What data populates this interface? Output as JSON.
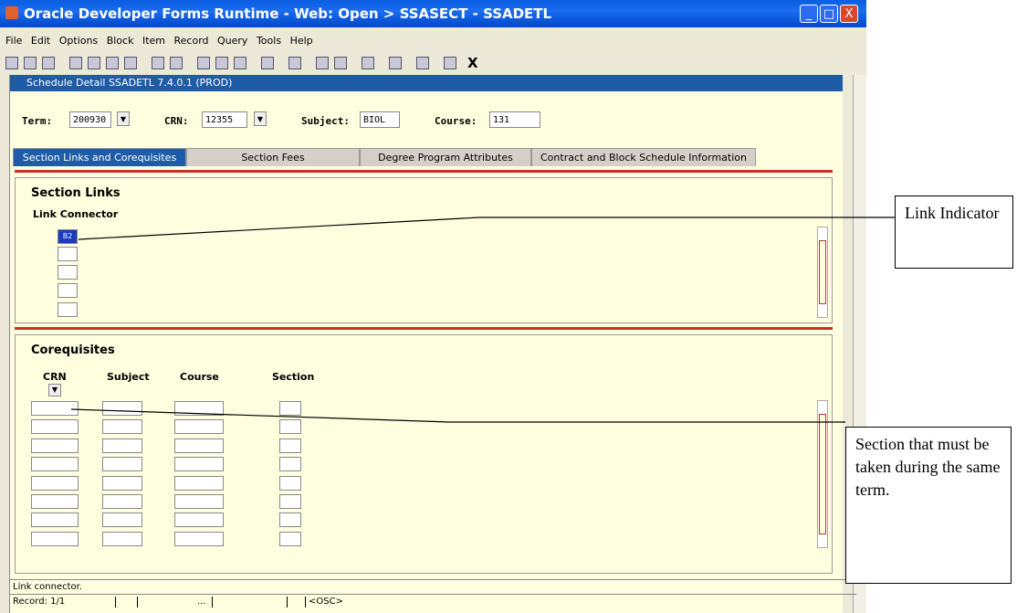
{
  "window": {
    "title": "Oracle Developer Forms Runtime - Web:  Open > SSASECT - SSADETL",
    "controls": {
      "minimize": "_",
      "maximize": "□",
      "close": "X"
    }
  },
  "menu": [
    "File",
    "Edit",
    "Options",
    "Block",
    "Item",
    "Record",
    "Query",
    "Tools",
    "Help"
  ],
  "toolbar": {
    "exit_label": "X"
  },
  "form": {
    "title": "Schedule Detail  SSADETL  7.4.0.1  (PROD)",
    "key": {
      "term_label": "Term:",
      "term_value": "200930",
      "crn_label": "CRN:",
      "crn_value": "12355",
      "subject_label": "Subject:",
      "subject_value": "BIOL",
      "course_label": "Course:",
      "course_value": "131"
    },
    "tabs": [
      "Section Links and Corequisites",
      "Section Fees",
      "Degree Program Attributes",
      "Contract and Block Schedule Information"
    ],
    "section_links": {
      "title": "Section Links",
      "column": "Link Connector",
      "rows": [
        "B2",
        "",
        "",
        "",
        ""
      ]
    },
    "corequisites": {
      "title": "Corequisites",
      "columns": [
        "CRN",
        "Subject",
        "Course",
        "Section"
      ]
    }
  },
  "status": {
    "message": "Link connector.",
    "record": "Record: 1/1",
    "ellipsis": "...",
    "mode": "<OSC>"
  },
  "annotations": {
    "link_indicator": "Link Indicator",
    "section_note": "Section that must be taken during the same term."
  }
}
